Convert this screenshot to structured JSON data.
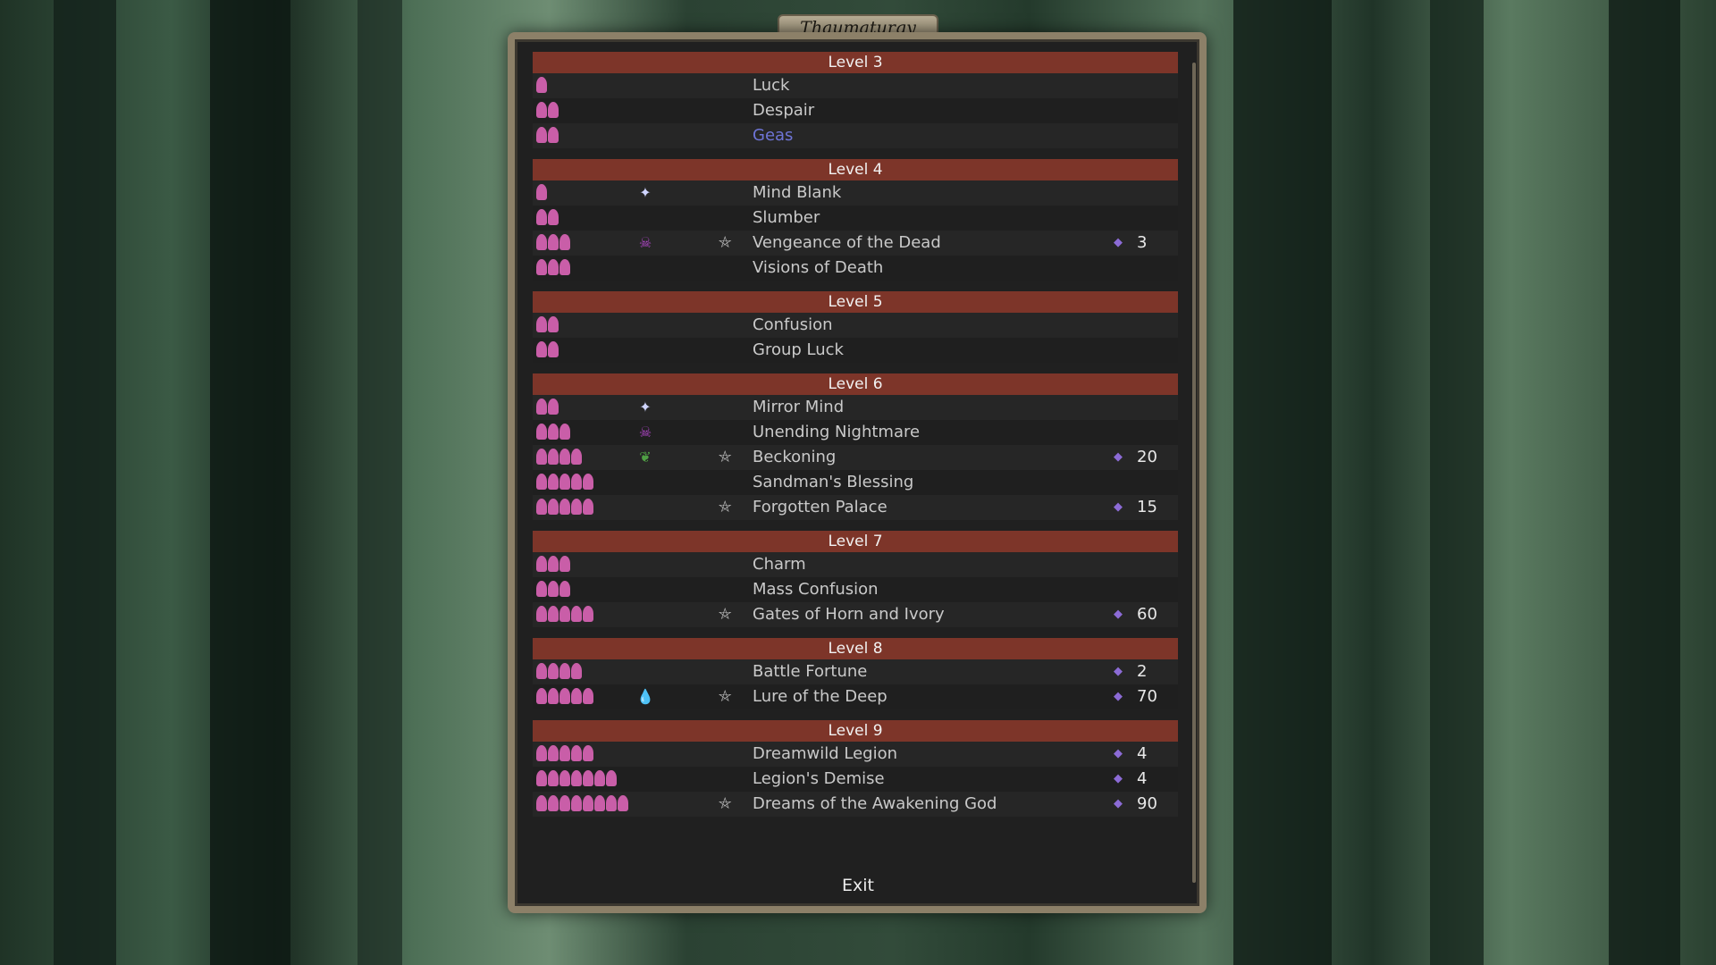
{
  "window": {
    "title": "Thaumaturgy"
  },
  "icons": {
    "cost_drop": "thaumaturgy-essence-icon",
    "ritual": "pentacle-icon",
    "gem": "gem-icon",
    "path_star": "star-icon",
    "path_skull": "skull-icon",
    "path_bush": "bush-icon",
    "path_water": "water-drops-icon"
  },
  "colors": {
    "level_header": "#7d3529",
    "selected_text": "#6e74d6",
    "drop": "#c95ea8"
  },
  "levels": [
    {
      "label": "Level 3",
      "spells": [
        {
          "name": "Luck",
          "drops": 1,
          "path": "",
          "ritual": false,
          "cost": ""
        },
        {
          "name": "Despair",
          "drops": 2,
          "path": "",
          "ritual": false,
          "cost": ""
        },
        {
          "name": "Geas",
          "drops": 2,
          "path": "",
          "ritual": false,
          "cost": "",
          "selected": true
        }
      ]
    },
    {
      "label": "Level 4",
      "spells": [
        {
          "name": "Mind Blank",
          "drops": 1,
          "path": "star",
          "ritual": false,
          "cost": ""
        },
        {
          "name": "Slumber",
          "drops": 2,
          "path": "",
          "ritual": false,
          "cost": ""
        },
        {
          "name": "Vengeance of the Dead",
          "drops": 3,
          "path": "skull",
          "ritual": true,
          "cost": "3"
        },
        {
          "name": "Visions of Death",
          "drops": 3,
          "path": "",
          "ritual": false,
          "cost": ""
        }
      ]
    },
    {
      "label": "Level 5",
      "spells": [
        {
          "name": "Confusion",
          "drops": 2,
          "path": "",
          "ritual": false,
          "cost": ""
        },
        {
          "name": "Group Luck",
          "drops": 2,
          "path": "",
          "ritual": false,
          "cost": ""
        }
      ]
    },
    {
      "label": "Level 6",
      "spells": [
        {
          "name": "Mirror Mind",
          "drops": 2,
          "path": "star",
          "ritual": false,
          "cost": ""
        },
        {
          "name": "Unending Nightmare",
          "drops": 3,
          "path": "skull",
          "ritual": false,
          "cost": ""
        },
        {
          "name": "Beckoning",
          "drops": 4,
          "path": "bush",
          "ritual": true,
          "cost": "20"
        },
        {
          "name": "Sandman's Blessing",
          "drops": 5,
          "path": "",
          "ritual": false,
          "cost": ""
        },
        {
          "name": "Forgotten Palace",
          "drops": 5,
          "path": "",
          "ritual": true,
          "cost": "15"
        }
      ]
    },
    {
      "label": "Level 7",
      "spells": [
        {
          "name": "Charm",
          "drops": 3,
          "path": "",
          "ritual": false,
          "cost": ""
        },
        {
          "name": "Mass Confusion",
          "drops": 3,
          "path": "",
          "ritual": false,
          "cost": ""
        },
        {
          "name": "Gates of Horn and Ivory",
          "drops": 5,
          "path": "",
          "ritual": true,
          "cost": "60"
        }
      ]
    },
    {
      "label": "Level 8",
      "spells": [
        {
          "name": "Battle Fortune",
          "drops": 4,
          "path": "",
          "ritual": false,
          "cost": "2"
        },
        {
          "name": "Lure of the Deep",
          "drops": 5,
          "path": "water",
          "ritual": true,
          "cost": "70"
        }
      ]
    },
    {
      "label": "Level 9",
      "spells": [
        {
          "name": "Dreamwild Legion",
          "drops": 5,
          "path": "",
          "ritual": false,
          "cost": "4"
        },
        {
          "name": "Legion's Demise",
          "drops": 7,
          "path": "",
          "ritual": false,
          "cost": "4"
        },
        {
          "name": "Dreams of the Awakening God",
          "drops": 8,
          "path": "",
          "ritual": true,
          "cost": "90"
        }
      ]
    }
  ],
  "footer": {
    "exit_label": "Exit"
  }
}
